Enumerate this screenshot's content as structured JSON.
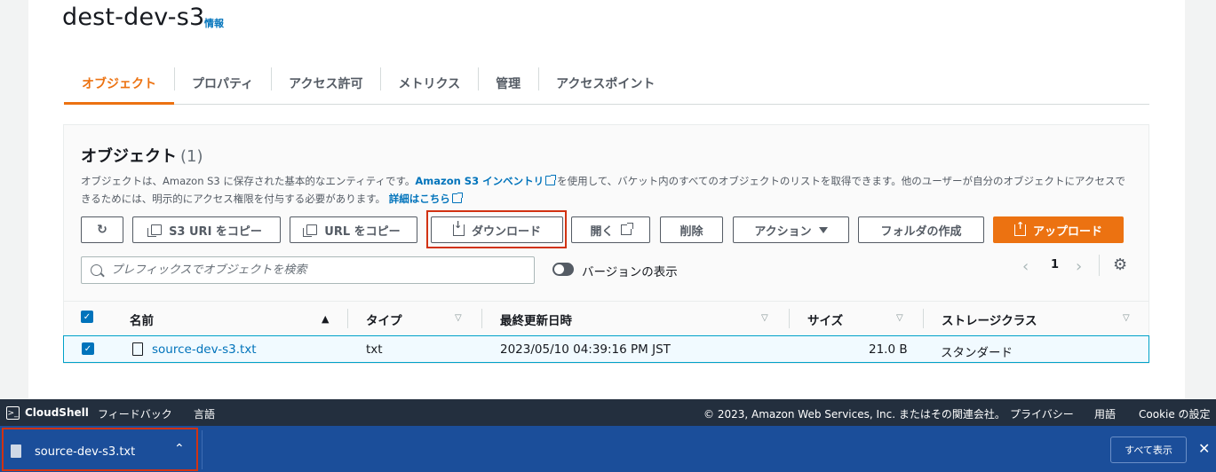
{
  "bucket": {
    "name": "dest-dev-s3",
    "info": "情報"
  },
  "tabs": [
    {
      "label": "オブジェクト",
      "active": true
    },
    {
      "label": "プロパティ"
    },
    {
      "label": "アクセス許可"
    },
    {
      "label": "メトリクス"
    },
    {
      "label": "管理"
    },
    {
      "label": "アクセスポイント"
    }
  ],
  "objects": {
    "title": "オブジェクト",
    "count": "(1)",
    "desc_1": "オブジェクトは、Amazon S3 に保存された基本的なエンティティです。",
    "desc_link_1": "Amazon S3 インベントリ",
    "desc_2": "を使用して、バケット内のすべてのオブジェクトのリストを取得できます。他のユーザーが自分のオブジェクトにアクセスできるためには、明示的にアクセス権限を付与する必要があります。",
    "desc_link_2": "詳細はこちら"
  },
  "toolbar": {
    "copy_s3_uri": "S3 URI をコピー",
    "copy_url": "URL をコピー",
    "download": "ダウンロード",
    "open": "開く",
    "delete": "削除",
    "actions": "アクション",
    "create_folder": "フォルダの作成",
    "upload": "アップロード"
  },
  "search": {
    "placeholder": "プレフィックスでオブジェクトを検索"
  },
  "versions_toggle": {
    "label": "バージョンの表示",
    "on": false
  },
  "pagination": {
    "page": "1"
  },
  "table": {
    "columns": [
      "名前",
      "タイプ",
      "最終更新日時",
      "サイズ",
      "ストレージクラス"
    ],
    "rows": [
      {
        "name": "source-dev-s3.txt",
        "type": "txt",
        "modified": "2023/05/10 04:39:16 PM JST",
        "size": "21.0 B",
        "storage_class": "スタンダード",
        "selected": true
      }
    ]
  },
  "footer": {
    "cloudshell": "CloudShell",
    "feedback": "フィードバック",
    "language": "言語",
    "copyright": "© 2023, Amazon Web Services, Inc. またはその関連会社。",
    "privacy": "プライバシー",
    "terms": "用語",
    "cookie": "Cookie の設定"
  },
  "download_shelf": {
    "file_name": "source-dev-s3.txt",
    "show_all": "すべて表示"
  },
  "colors": {
    "accent": "#ec7211",
    "link": "#0073bb",
    "highlight": "#d13212",
    "footer_bg": "#232f3e",
    "download_bar_bg": "#1b4e9a"
  }
}
